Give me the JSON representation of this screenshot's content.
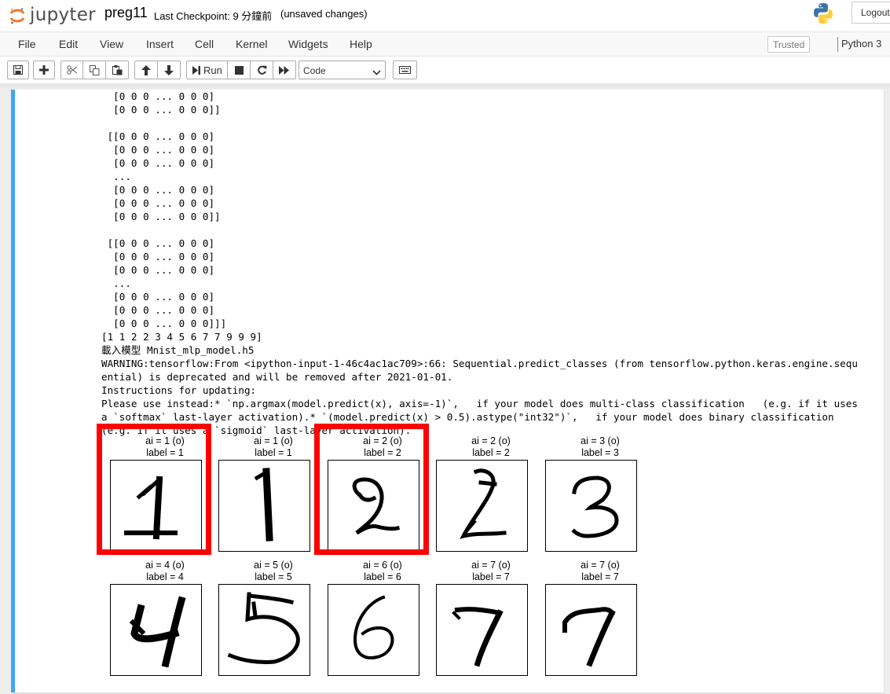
{
  "header": {
    "logo_text": "jupyter",
    "notebook_name": "preg11",
    "checkpoint": "Last Checkpoint: 9 分鐘前",
    "unsaved": "(unsaved changes)",
    "logout_label": "Logout"
  },
  "menubar": {
    "items": [
      "File",
      "Edit",
      "View",
      "Insert",
      "Cell",
      "Kernel",
      "Widgets",
      "Help"
    ],
    "trusted": "Trusted",
    "kernel": "Python 3"
  },
  "toolbar": {
    "run_label": "Run",
    "cell_type": "Code"
  },
  "output_lines": [
    "  [0 0 0 ... 0 0 0]",
    "  [0 0 0 ... 0 0 0]]",
    "",
    " [[0 0 0 ... 0 0 0]",
    "  [0 0 0 ... 0 0 0]",
    "  [0 0 0 ... 0 0 0]",
    "  ...",
    "  [0 0 0 ... 0 0 0]",
    "  [0 0 0 ... 0 0 0]",
    "  [0 0 0 ... 0 0 0]]",
    "",
    " [[0 0 0 ... 0 0 0]",
    "  [0 0 0 ... 0 0 0]",
    "  [0 0 0 ... 0 0 0]",
    "  ...",
    "  [0 0 0 ... 0 0 0]",
    "  [0 0 0 ... 0 0 0]",
    "  [0 0 0 ... 0 0 0]]]",
    "[1 1 2 2 3 4 5 6 7 7 9 9 9]",
    "載入模型 Mnist_mlp_model.h5",
    "WARNING:tensorflow:From <ipython-input-1-46c4ac1ac709>:66: Sequential.predict_classes (from tensorflow.python.keras.engine.sequ",
    "ential) is deprecated and will be removed after 2021-01-01.",
    "Instructions for updating:",
    "Please use instead:* `np.argmax(model.predict(x), axis=-1)`,   if your model does multi-class classification   (e.g. if it uses",
    "a `softmax` last-layer activation).* `(model.predict(x) > 0.5).astype(\"int32\")`,   if your model does binary classification",
    "(e.g. if it uses a `sigmoid` last-layer activation)."
  ],
  "digits": [
    {
      "ai": "ai = 1 (o)",
      "label": "label = 1",
      "highlighted": true,
      "glyph": "digit-1"
    },
    {
      "ai": "ai = 1 (o)",
      "label": "label = 1",
      "highlighted": false,
      "glyph": "digit-1"
    },
    {
      "ai": "ai = 2 (o)",
      "label": "label = 2",
      "highlighted": true,
      "glyph": "digit-2"
    },
    {
      "ai": "ai = 2 (o)",
      "label": "label = 2",
      "highlighted": false,
      "glyph": "digit-2"
    },
    {
      "ai": "ai = 3 (o)",
      "label": "label = 3",
      "highlighted": false,
      "glyph": "digit-3"
    },
    {
      "ai": "ai = 4 (o)",
      "label": "label = 4",
      "highlighted": false,
      "glyph": "digit-4"
    },
    {
      "ai": "ai = 5 (o)",
      "label": "label = 5",
      "highlighted": false,
      "glyph": "digit-5"
    },
    {
      "ai": "ai = 6 (o)",
      "label": "label = 6",
      "highlighted": false,
      "glyph": "digit-6"
    },
    {
      "ai": "ai = 7 (o)",
      "label": "label = 7",
      "highlighted": false,
      "glyph": "digit-7"
    },
    {
      "ai": "ai = 7 (o)",
      "label": "label = 7",
      "highlighted": false,
      "glyph": "digit-7"
    }
  ],
  "colors": {
    "cell_bar": "#42a5f5",
    "highlight": "#ff0000",
    "jupyter_orange": "#f37626"
  }
}
